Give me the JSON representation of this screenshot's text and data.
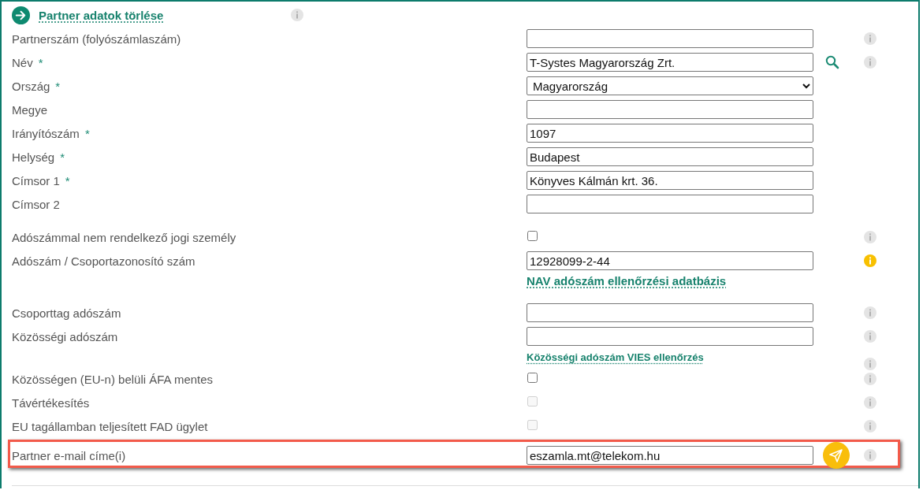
{
  "header": {
    "title": "Partner adatok törlése",
    "info": {
      "kind": "plain"
    }
  },
  "sections": [
    {
      "rows": [
        {
          "kind": "text",
          "label": "Partnerszám (folyószámlaszám)",
          "value": "",
          "info": {
            "kind": "plain"
          }
        },
        {
          "kind": "text",
          "label": "Név",
          "required_mark": "*",
          "value": "T-Systes Magyarország Zrt.",
          "action": {
            "kind": "search"
          },
          "info": {
            "kind": "plain"
          }
        },
        {
          "kind": "select",
          "label": "Ország",
          "required_mark": "*",
          "value": "Magyarország"
        },
        {
          "kind": "text",
          "label": "Megye",
          "value": ""
        },
        {
          "kind": "text",
          "label": "Irányítószám",
          "required_mark": "*",
          "value": "1097"
        },
        {
          "kind": "text",
          "label": "Helység",
          "required_mark": "*",
          "value": "Budapest"
        },
        {
          "kind": "text",
          "label": "Címsor 1",
          "required_mark": "*",
          "value": "Könyves Kálmán krt. 36."
        },
        {
          "kind": "text",
          "label": "Címsor 2",
          "value": ""
        }
      ]
    },
    {
      "rows": [
        {
          "kind": "checkbox",
          "label": "Adószámmal nem rendelkező jogi személy",
          "checked": false,
          "disabled": false,
          "info": {
            "kind": "plain"
          }
        },
        {
          "kind": "text",
          "label": "Adószám / Csoportazonosító szám",
          "value": "12928099-2-44",
          "info": {
            "kind": "warning"
          }
        },
        {
          "kind": "link",
          "link": "NAV adószám ellenőrzési adatbázis",
          "prominent": true
        }
      ]
    },
    {
      "rows": [
        {
          "kind": "text",
          "label": "Csoporttag adószám",
          "value": "",
          "info": {
            "kind": "plain"
          }
        },
        {
          "kind": "text",
          "label": "Közösségi adószám",
          "value": "",
          "info": {
            "kind": "plain"
          }
        },
        {
          "kind": "link",
          "link": "Közösségi adószám VIES ellenőrzés",
          "prominent": false,
          "info": {
            "kind": "plain"
          }
        },
        {
          "kind": "checkbox",
          "label": "Közösségen (EU-n) belüli ÁFA mentes",
          "checked": false,
          "disabled": false,
          "info": {
            "kind": "plain"
          }
        },
        {
          "kind": "checkbox",
          "label": "Távértékesítés",
          "checked": false,
          "disabled": true,
          "info": {
            "kind": "plain"
          }
        },
        {
          "kind": "checkbox",
          "label": "EU tagállamban teljesített FAD ügylet",
          "checked": false,
          "disabled": true,
          "info": {
            "kind": "plain"
          }
        },
        {
          "kind": "text",
          "label": "Partner e-mail címe(i)",
          "value": "eszamla.mt@telekom.hu",
          "action": {
            "kind": "send"
          },
          "info": {
            "kind": "plain"
          },
          "highlighted": true
        }
      ]
    }
  ]
}
